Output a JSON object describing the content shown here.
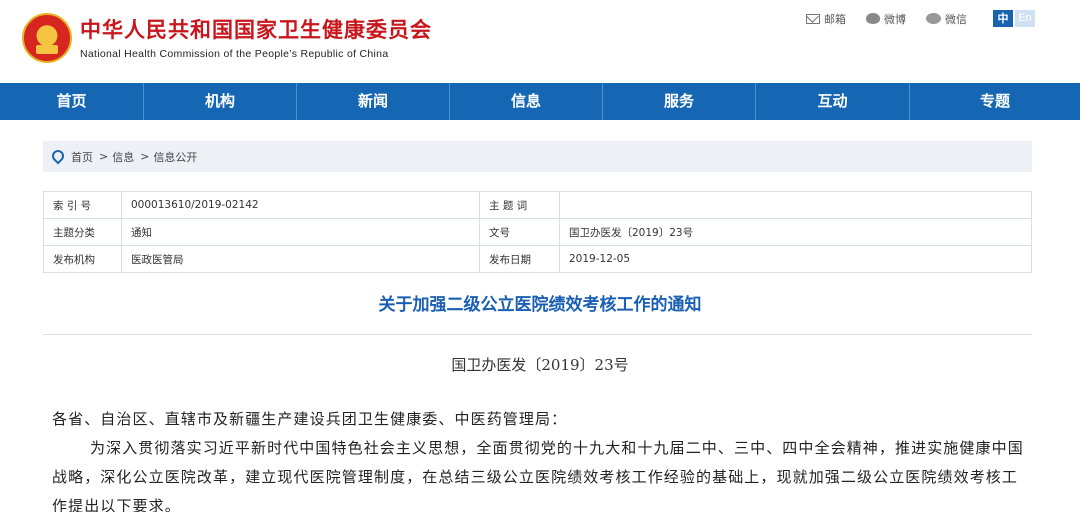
{
  "header": {
    "title_cn": "中华人民共和国国家卫生健康委员会",
    "title_en": "National Health Commission of the People’s Republic of China",
    "links": [
      {
        "label": "邮箱",
        "icon": "mail-icon"
      },
      {
        "label": "微博",
        "icon": "weibo-icon"
      },
      {
        "label": "微信",
        "icon": "wechat-icon"
      }
    ],
    "lang_zh": "中",
    "lang_en": "En"
  },
  "nav": {
    "items": [
      "首页",
      "机构",
      "新闻",
      "信息",
      "服务",
      "互动",
      "专题"
    ]
  },
  "breadcrumb": {
    "items": [
      "首页",
      "信息",
      "信息公开"
    ],
    "separator": ">"
  },
  "info": {
    "rows": [
      {
        "label1": "索 引 号",
        "value1": "000013610/2019-02142",
        "label2": "主 题 词",
        "value2": ""
      },
      {
        "label1": "主题分类",
        "value1": "通知",
        "label2": "文号",
        "value2": "国卫办医发〔2019〕23号"
      },
      {
        "label1": "发布机构",
        "value1": "医政医管局",
        "label2": "发布日期",
        "value2": "2019-12-05"
      }
    ]
  },
  "article": {
    "title": "关于加强二级公立医院绩效考核工作的通知",
    "doc_number": "国卫办医发〔2019〕23号",
    "salutation": "各省、自治区、直辖市及新疆生产建设兵团卫生健康委、中医药管理局：",
    "paragraph1": "为深入贯彻落实习近平新时代中国特色社会主义思想，全面贯彻党的十九大和十九届二中、三中、四中全会精神，推进实施健康中国战略，深化公立医院改革，建立现代医院管理制度，在总结三级公立医院绩效考核工作经验的基础上，现就加强二级公立医院绩效考核工作提出以下要求。"
  },
  "colors": {
    "brand_red": "#c8161d",
    "nav_blue": "#1566b3",
    "title_blue": "#1a5fb4"
  }
}
